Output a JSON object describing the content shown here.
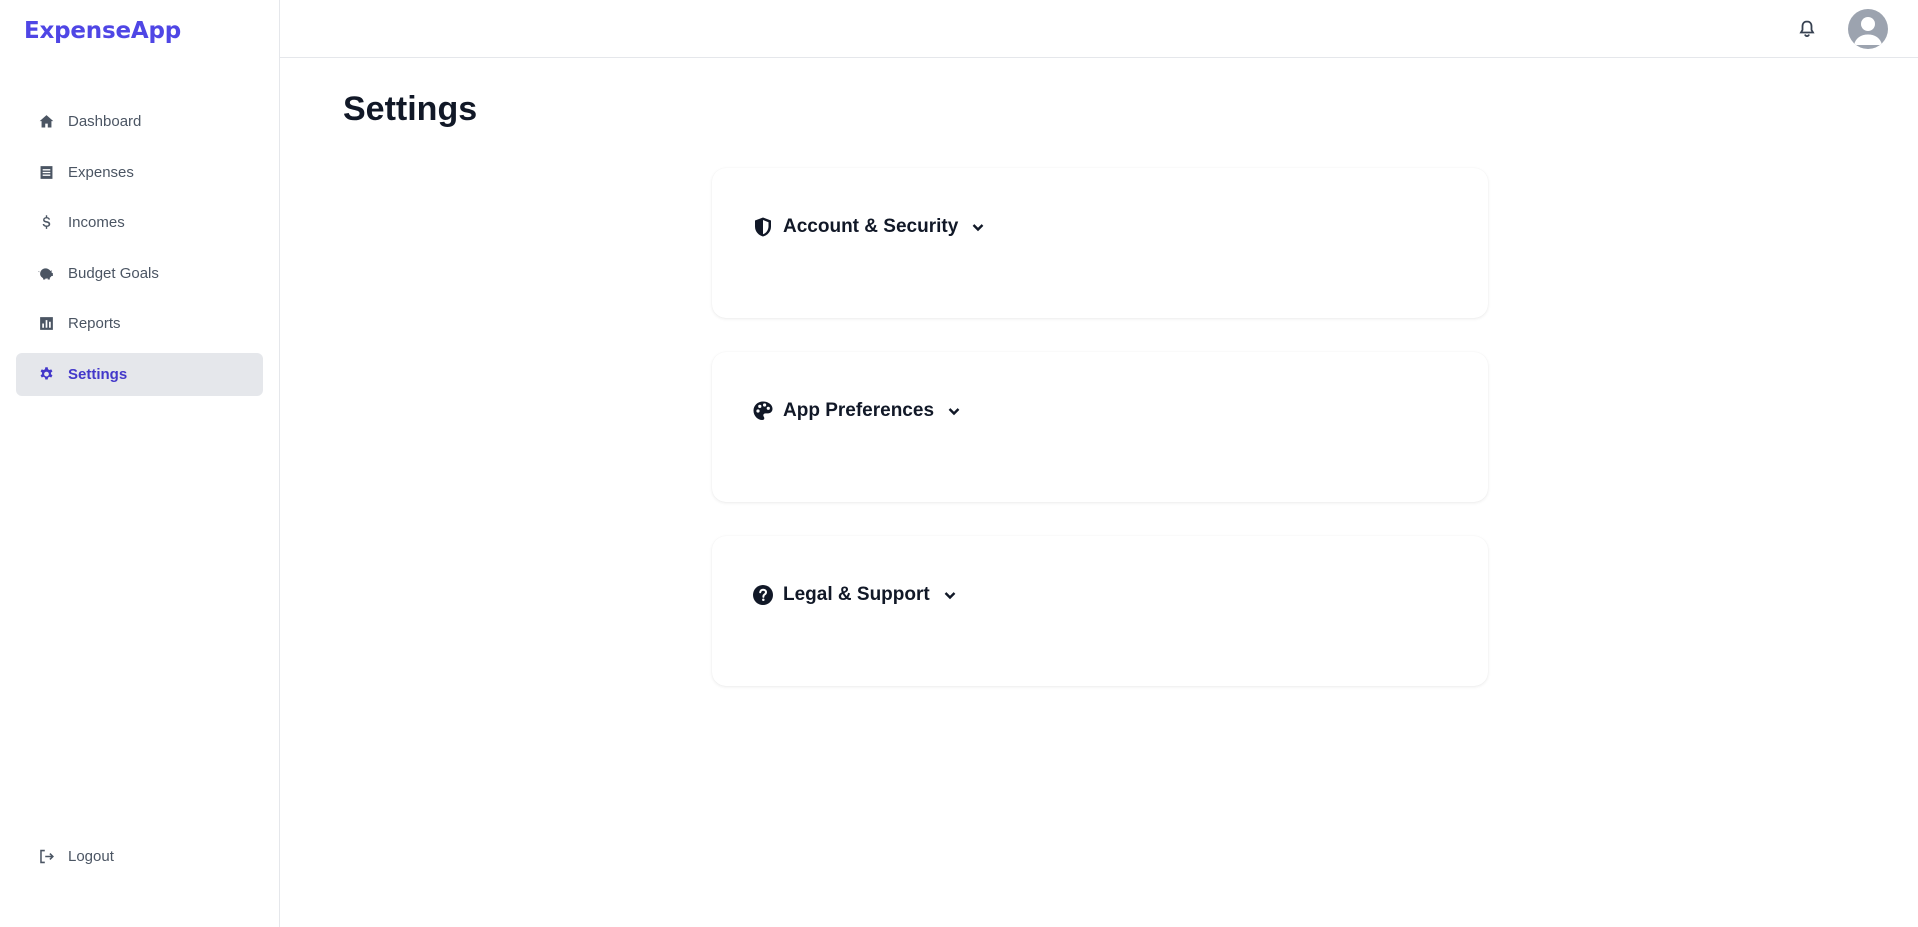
{
  "app": {
    "name": "ExpenseApp",
    "accent_color": "#4f46e5"
  },
  "sidebar": {
    "items": [
      {
        "label": "Dashboard",
        "icon": "home-icon",
        "active": false
      },
      {
        "label": "Expenses",
        "icon": "list-icon",
        "active": false
      },
      {
        "label": "Incomes",
        "icon": "dollar-icon",
        "active": false
      },
      {
        "label": "Budget Goals",
        "icon": "piggy-bank-icon",
        "active": false
      },
      {
        "label": "Reports",
        "icon": "chart-bar-icon",
        "active": false
      },
      {
        "label": "Settings",
        "icon": "gear-icon",
        "active": true
      }
    ],
    "logout_label": "Logout"
  },
  "header": {
    "notifications_icon": "bell-icon",
    "avatar_icon": "user-avatar-icon"
  },
  "page": {
    "title": "Settings",
    "sections": [
      {
        "title": "Account & Security",
        "icon": "shield-icon",
        "expanded": false
      },
      {
        "title": "App Preferences",
        "icon": "palette-icon",
        "expanded": false
      },
      {
        "title": "Legal & Support",
        "icon": "question-circle-icon",
        "expanded": false
      }
    ]
  }
}
